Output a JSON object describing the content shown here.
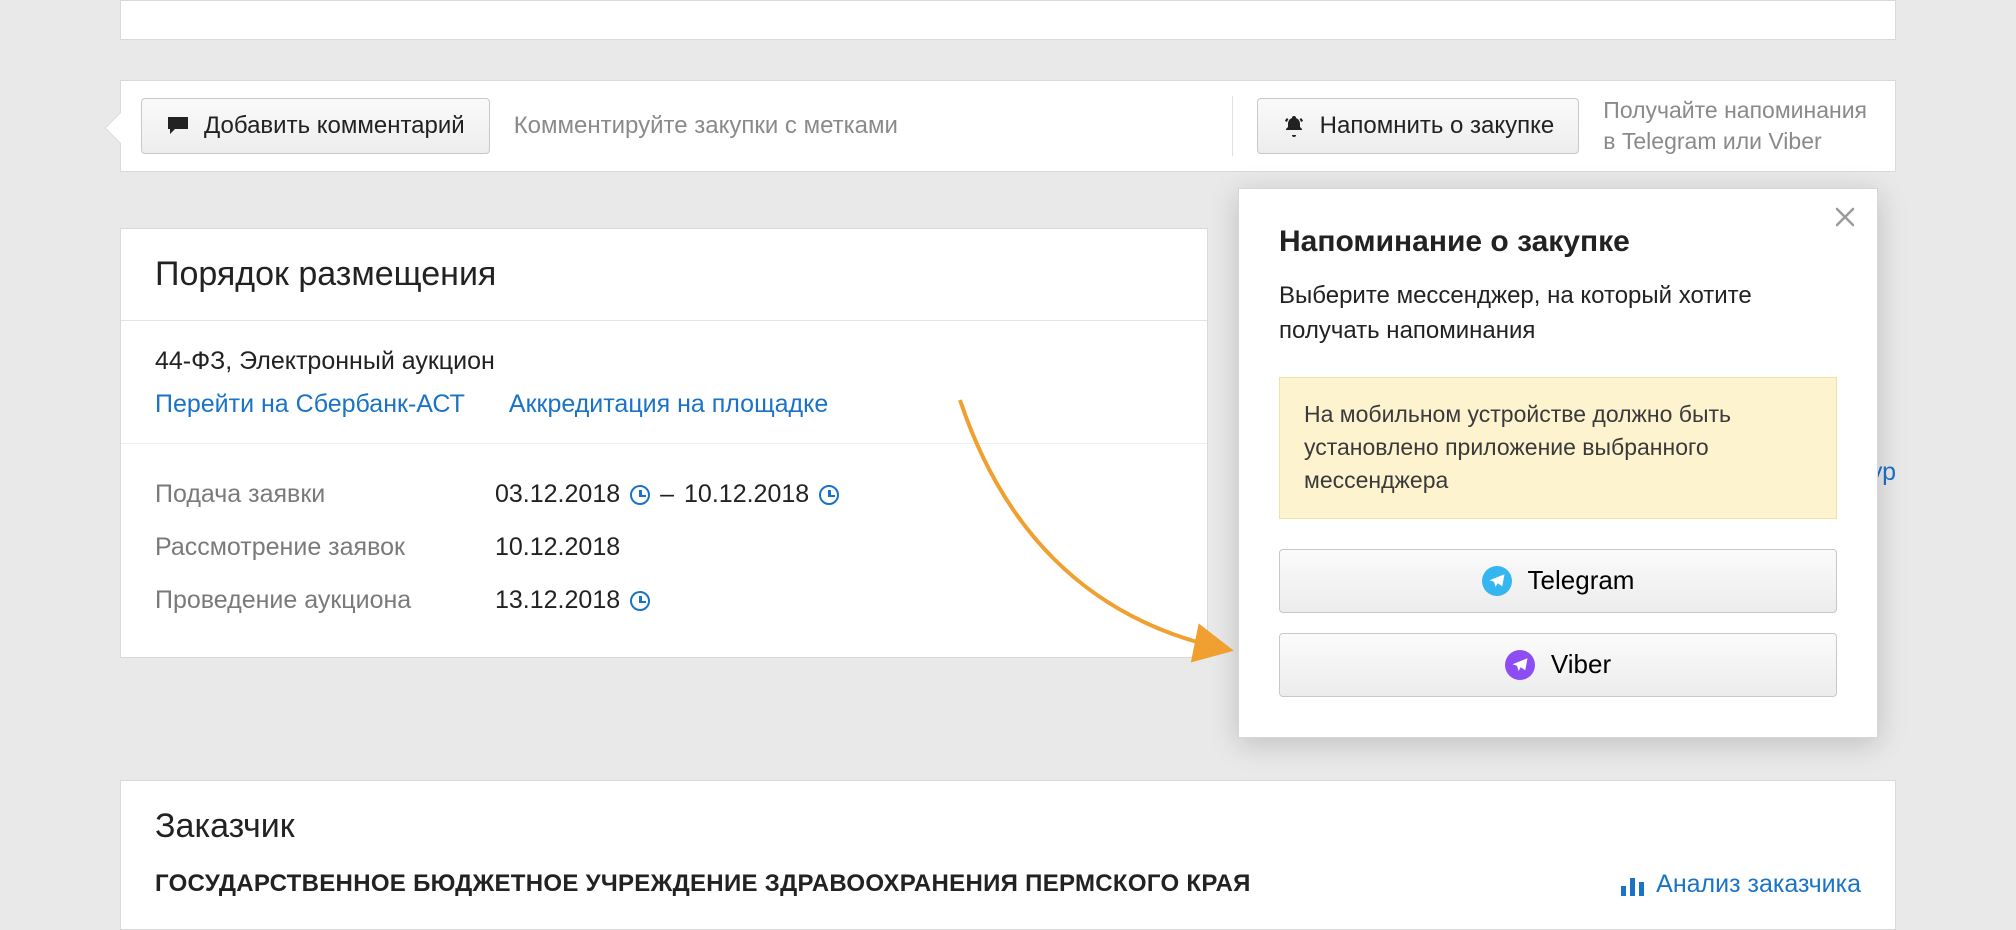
{
  "commentbar": {
    "add_comment_label": "Добавить комментарий",
    "hint": "Комментируйте закупки с метками",
    "remind_label": "Напомнить о закупке",
    "hint2_line1": "Получайте напоминания",
    "hint2_line2": "в Telegram или Viber"
  },
  "card": {
    "title": "Порядок размещения",
    "type": "44-ФЗ, Электронный аукцион",
    "link1": "Перейти на Сбербанк-АСТ",
    "link2": "Аккредитация на площадке",
    "rows": [
      {
        "label": "Подача заявки",
        "val": "03.12.2018",
        "dash": "–",
        "val2": "10.12.2018",
        "clock1": true,
        "clock2": true
      },
      {
        "label": "Рассмотрение заявок",
        "val": "10.12.2018",
        "clock1": false
      },
      {
        "label": "Проведение аукциона",
        "val": "13.12.2018",
        "clock1": true
      }
    ]
  },
  "rightlink": "онтур",
  "card2": {
    "title": "Заказчик",
    "name": "ГОСУДАРСТВЕННОЕ БЮДЖЕТНОЕ УЧРЕЖДЕНИЕ ЗДРАВООХРАНЕНИЯ ПЕРМСКОГО КРАЯ",
    "analysis_label": "Анализ заказчика"
  },
  "popover": {
    "title": "Напоминание о закупке",
    "desc": "Выберите мессенджер, на который хотите получать напоминания",
    "note": "На мобильном устройстве должно быть установлено приложение выбранного мессенджера",
    "telegram_label": "Telegram",
    "viber_label": "Viber"
  }
}
